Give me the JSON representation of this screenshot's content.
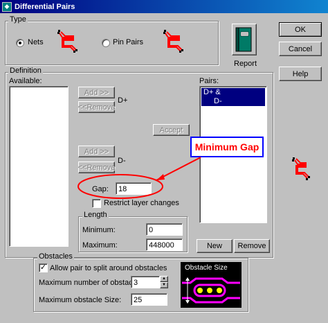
{
  "window": {
    "title": "Differential Pairs"
  },
  "buttons": {
    "ok": "OK",
    "cancel": "Cancel",
    "help": "Help"
  },
  "type_group": {
    "label": "Type",
    "nets_label": "Nets",
    "pinpairs_label": "Pin Pairs",
    "selected": "Nets",
    "report_label": "Report"
  },
  "definition": {
    "label": "Definition",
    "available_label": "Available:",
    "pairs_label": "Pairs:",
    "add1_label": "Add >>",
    "remove1_label": "<<Remove",
    "dplus_label": "D+",
    "accept_label": "Accept",
    "add2_label": "Add >>",
    "remove2_label": "<<Remove",
    "dminus_label": "D-",
    "gap_label": "Gap:",
    "gap_value": "18",
    "restrict_label": "Restrict layer changes",
    "restrict_checked": false,
    "pairs": [
      {
        "text": "D+ &",
        "selected": true
      },
      {
        "text": "D-",
        "selected": true
      }
    ],
    "new_label": "New",
    "remove_label": "Remove"
  },
  "length": {
    "label": "Length",
    "minimum_label": "Minimum:",
    "minimum_value": "0",
    "maximum_label": "Maximum:",
    "maximum_value": "448000"
  },
  "obstacles": {
    "label": "Obstacles",
    "allow_label": "Allow pair to split around obstacles",
    "allow_checked": true,
    "max_number_label": "Maximum number of obstacles:",
    "max_number_value": "3",
    "max_size_label": "Maximum obstacle Size:",
    "max_size_value": "25",
    "preview_label": "Obstacle Size"
  },
  "annotation": {
    "text": "Minimum Gap",
    "color": "#ff0000",
    "box_border": "#0000ff"
  },
  "colors": {
    "trace": "#ff0000",
    "obstacle_trace": "#ff00ff",
    "obstacle_pad": "#ffff00"
  }
}
